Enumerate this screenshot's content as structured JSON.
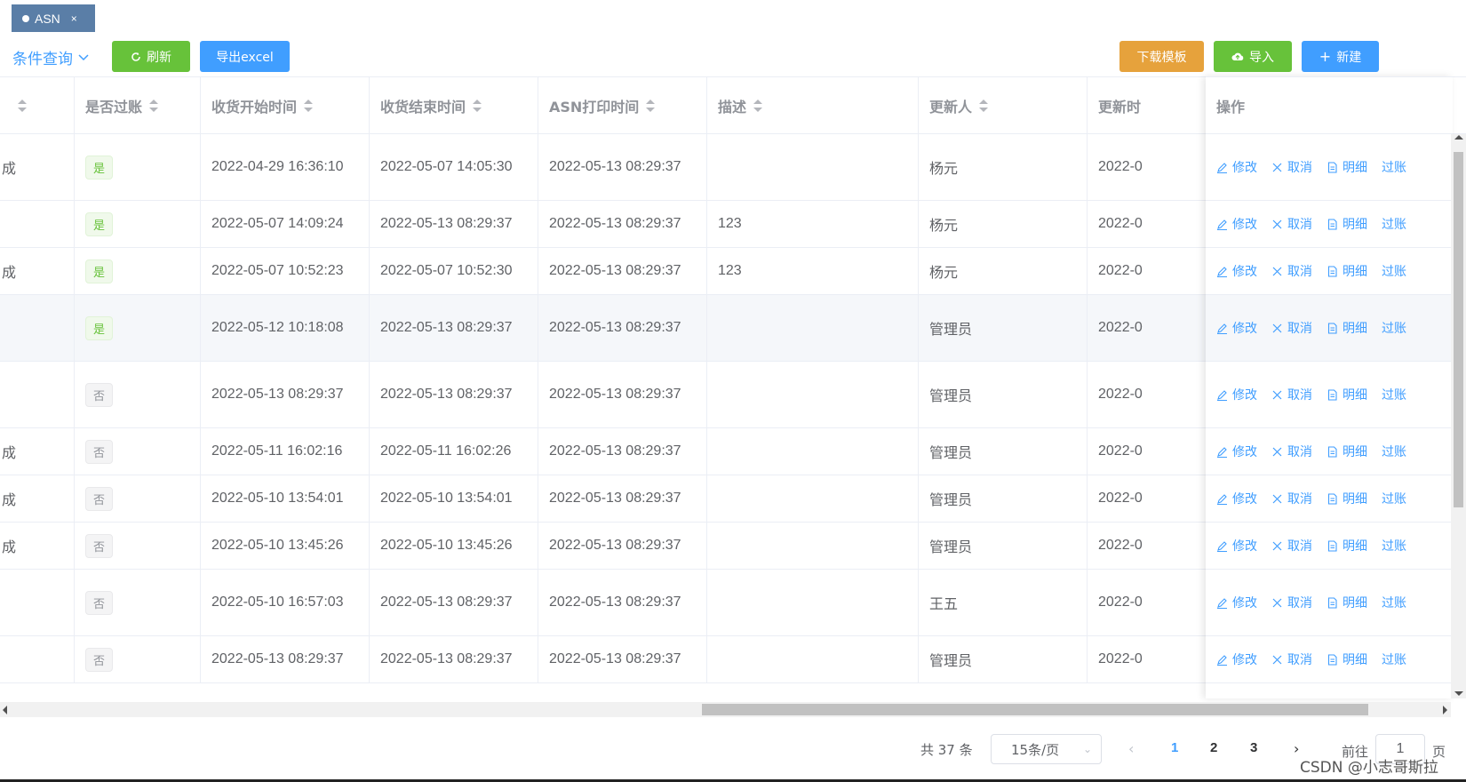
{
  "tabs": [
    {
      "label": "ASN",
      "close": "×"
    }
  ],
  "toolbar": {
    "condition_label": "条件查询",
    "refresh": "刷新",
    "export": "导出excel",
    "download_template": "下载模板",
    "import": "导入",
    "create": "新建"
  },
  "table": {
    "columns": [
      "是否过账",
      "收货开始时间",
      "收货结束时间",
      "ASN打印时间",
      "描述",
      "更新人",
      "更新时"
    ],
    "ops_header": "操作",
    "rows": [
      {
        "prefix": "成",
        "posted": "是",
        "start": "2022-04-29 16:36:10",
        "end": "2022-05-07 14:05:30",
        "print": "2022-05-13 08:29:37",
        "desc": "",
        "updater": "杨元",
        "updated": "2022-0"
      },
      {
        "prefix": "",
        "posted": "是",
        "start": "2022-05-07 14:09:24",
        "end": "2022-05-13 08:29:37",
        "print": "2022-05-13 08:29:37",
        "desc": "123",
        "updater": "杨元",
        "updated": "2022-0"
      },
      {
        "prefix": "成",
        "posted": "是",
        "start": "2022-05-07 10:52:23",
        "end": "2022-05-07 10:52:30",
        "print": "2022-05-13 08:29:37",
        "desc": "123",
        "updater": "杨元",
        "updated": "2022-0"
      },
      {
        "prefix": "",
        "posted": "是",
        "start": "2022-05-12 10:18:08",
        "end": "2022-05-13 08:29:37",
        "print": "2022-05-13 08:29:37",
        "desc": "",
        "updater": "管理员",
        "updated": "2022-0"
      },
      {
        "prefix": "",
        "posted": "否",
        "start": "2022-05-13 08:29:37",
        "end": "2022-05-13 08:29:37",
        "print": "2022-05-13 08:29:37",
        "desc": "",
        "updater": "管理员",
        "updated": "2022-0"
      },
      {
        "prefix": "成",
        "posted": "否",
        "start": "2022-05-11 16:02:16",
        "end": "2022-05-11 16:02:26",
        "print": "2022-05-13 08:29:37",
        "desc": "",
        "updater": "管理员",
        "updated": "2022-0"
      },
      {
        "prefix": "成",
        "posted": "否",
        "start": "2022-05-10 13:54:01",
        "end": "2022-05-10 13:54:01",
        "print": "2022-05-13 08:29:37",
        "desc": "",
        "updater": "管理员",
        "updated": "2022-0"
      },
      {
        "prefix": "成",
        "posted": "否",
        "start": "2022-05-10 13:45:26",
        "end": "2022-05-10 13:45:26",
        "print": "2022-05-13 08:29:37",
        "desc": "",
        "updater": "管理员",
        "updated": "2022-0"
      },
      {
        "prefix": "",
        "posted": "否",
        "start": "2022-05-10 16:57:03",
        "end": "2022-05-13 08:29:37",
        "print": "2022-05-13 08:29:37",
        "desc": "",
        "updater": "王五",
        "updated": "2022-0"
      },
      {
        "prefix": "",
        "posted": "否",
        "start": "2022-05-13 08:29:37",
        "end": "2022-05-13 08:29:37",
        "print": "2022-05-13 08:29:37",
        "desc": "",
        "updater": "管理员",
        "updated": "2022-0"
      }
    ],
    "actions": [
      "修改",
      "取消",
      "明细",
      "过账"
    ]
  },
  "pagination": {
    "total": "共 37 条",
    "page_size": "15条/页",
    "pages": [
      "1",
      "2",
      "3"
    ],
    "current": "1",
    "goto_label": "前往",
    "goto_value": "1",
    "goto_unit": "页"
  },
  "watermark": "CSDN @小志哥斯拉",
  "colors": {
    "primary": "#409eff",
    "success": "#67c23a",
    "warning": "#e6a23c",
    "tag": "#5a7ea7"
  }
}
